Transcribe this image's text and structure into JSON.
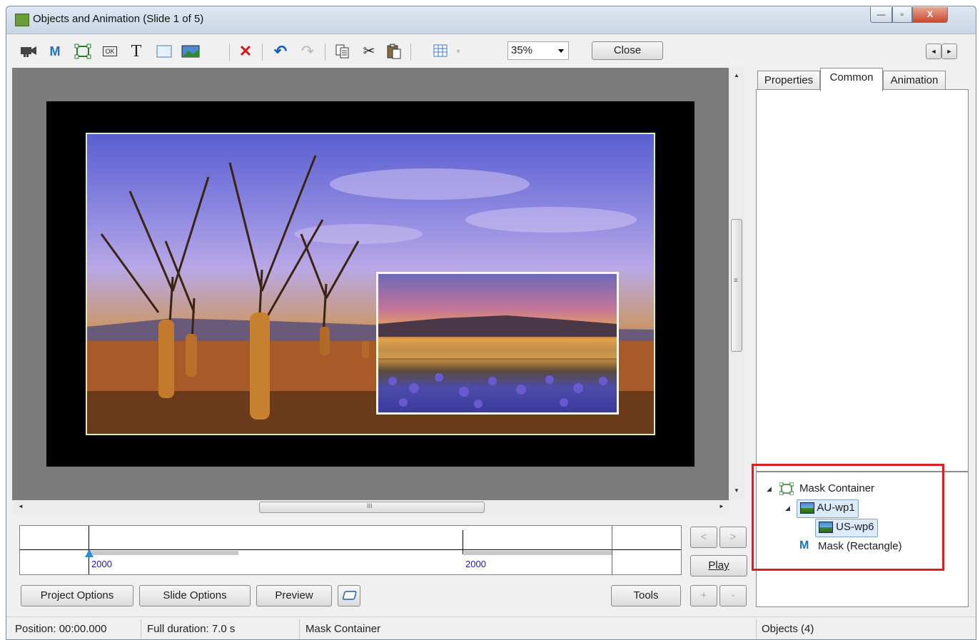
{
  "window": {
    "title": "Objects and Animation  (Slide 1 of 5)",
    "controls": {
      "minimize": "—",
      "maximize": "▫",
      "close": "X"
    }
  },
  "toolbar": {
    "icons": [
      "camera-icon",
      "mask-icon",
      "frame-icon",
      "button-icon",
      "text-icon",
      "rectangle-icon",
      "image-icon",
      "delete-icon",
      "undo-icon",
      "redo-icon",
      "copy-icon",
      "cut-icon",
      "paste-icon",
      "grid-icon"
    ],
    "mask_glyph": "M",
    "text_glyph": "T",
    "button_glyph": "OK",
    "delete_glyph": "✕",
    "undo_glyph": "↶",
    "redo_glyph": "↷",
    "cut_glyph": "✂",
    "zoom_value": "35%",
    "close_label": "Close"
  },
  "tabs": [
    {
      "label": "Properties",
      "active": false
    },
    {
      "label": "Common",
      "active": true
    },
    {
      "label": "Animation",
      "active": false
    }
  ],
  "object_tree": [
    {
      "label": "Mask Container",
      "icon": "frame-icon",
      "level": 0,
      "expanded": true
    },
    {
      "label": "AU-wp1",
      "icon": "image-icon",
      "level": 1,
      "expanded": true,
      "selected": true
    },
    {
      "label": "US-wp6",
      "icon": "image-icon",
      "level": 2,
      "selected": true
    },
    {
      "label": "Mask (Rectangle)",
      "icon": "mask-icon",
      "level": 1
    }
  ],
  "timeline": {
    "labels": [
      "2000",
      "2000"
    ]
  },
  "side_buttons": {
    "prev": "<",
    "next": ">",
    "play": "Play",
    "add": "+",
    "remove": "-"
  },
  "bottom_buttons": {
    "project_options": "Project Options",
    "slide_options": "Slide Options",
    "preview": "Preview",
    "tools": "Tools"
  },
  "statusbar": {
    "position": "Position:  00:00.000",
    "duration": "Full duration:  7.0 s",
    "selected": "Mask Container",
    "objects": "Objects (4)"
  },
  "scroll": {
    "up": "▲",
    "down": "▼",
    "left": "◄",
    "right": "►",
    "vgrip": "≡",
    "hgrip": "III"
  },
  "colors": {
    "highlight_box": "#e11b22",
    "accent_blue": "#1a73c8",
    "canvas_bg": "#7b7b7b"
  }
}
